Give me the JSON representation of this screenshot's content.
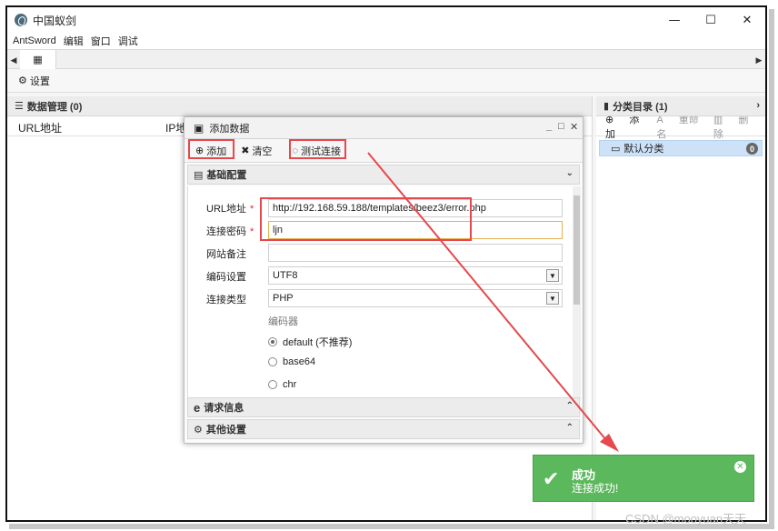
{
  "window": {
    "title": "中国蚁剑",
    "controls": {
      "minimize": "—",
      "maximize": "☐",
      "close": "✕"
    }
  },
  "menu": [
    "AntSword",
    "编辑",
    "窗口",
    "调试"
  ],
  "toolbar": {
    "settings_label": "设置"
  },
  "data_panel": {
    "title": "数据管理 (0)",
    "columns": [
      "URL地址",
      "IP地"
    ]
  },
  "category_panel": {
    "title": "分类目录 (1)",
    "actions": [
      "添加",
      "重命名",
      "删除"
    ],
    "items": [
      {
        "label": "默认分类",
        "count": "0"
      }
    ]
  },
  "dialog": {
    "title": "添加数据",
    "toolbar": {
      "add": "添加",
      "clear": "清空",
      "test": "测试连接"
    },
    "sections": {
      "basic": "基础配置",
      "request": "请求信息",
      "other": "其他设置"
    },
    "form": {
      "url_label": "URL地址",
      "url_value": "http://192.168.59.188/templates/beez3/error.php",
      "password_label": "连接密码",
      "password_value": "ljn",
      "note_label": "网站备注",
      "note_value": "",
      "encoding_label": "编码设置",
      "encoding_value": "UTF8",
      "type_label": "连接类型",
      "type_value": "PHP",
      "encoder_label": "编码器",
      "encoders": [
        {
          "label": "default (不推荐)",
          "selected": true
        },
        {
          "label": "base64",
          "selected": false
        },
        {
          "label": "chr",
          "selected": false
        }
      ],
      "required_mark": "*"
    }
  },
  "toast": {
    "title": "成功",
    "message": "连接成功!"
  },
  "watermark": "CSDN @mooyuan天天",
  "colors": {
    "annotation_red": "#e5484d",
    "toast_green": "#5cb85c",
    "selection_blue": "#cde2f7"
  }
}
